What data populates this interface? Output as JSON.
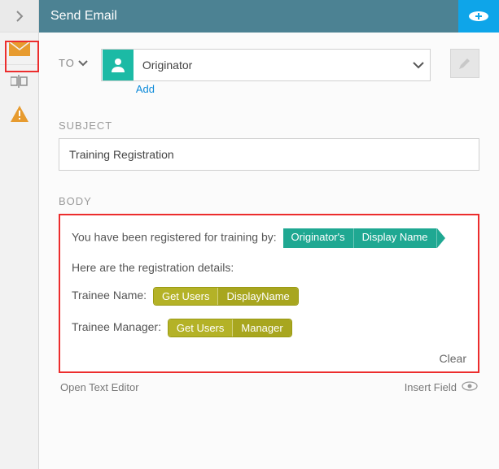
{
  "titlebar": {
    "title": "Send Email"
  },
  "sidebar": {
    "items": [
      {
        "name": "collapse",
        "icon": "chevron-right"
      },
      {
        "name": "email",
        "icon": "envelope",
        "active": true
      },
      {
        "name": "rename",
        "icon": "rename"
      },
      {
        "name": "warning",
        "icon": "warning"
      }
    ]
  },
  "to": {
    "label": "TO",
    "value": "Originator",
    "add_label": "Add"
  },
  "subject": {
    "label": "SUBJECT",
    "value": "Training Registration"
  },
  "body": {
    "label": "BODY",
    "line1_prefix": "You have been registered for training by:",
    "token1_a": "Originator's",
    "token1_b": "Display Name",
    "line2": "Here are the registration details:",
    "line3_prefix": "Trainee Name:",
    "token3_a": "Get Users",
    "token3_b": "DisplayName",
    "line4_prefix": "Trainee Manager:",
    "token4_a": "Get Users",
    "token4_b": "Manager",
    "clear_label": "Clear"
  },
  "footer": {
    "open_editor": "Open Text Editor",
    "insert_field": "Insert Field"
  }
}
